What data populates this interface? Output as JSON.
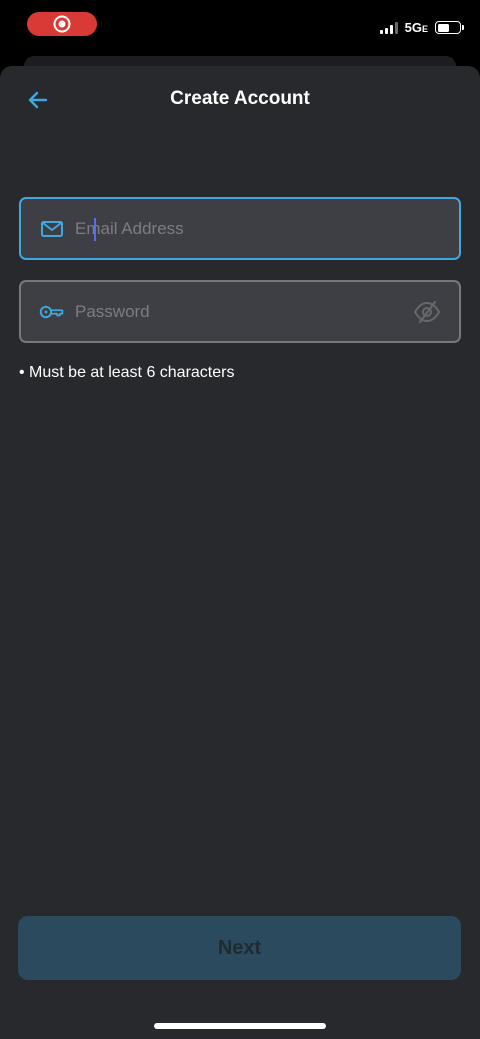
{
  "status_bar": {
    "network": "5G",
    "network_suffix": "E",
    "signal_bars": 3,
    "battery_level": 0.6,
    "recording_color": "#d93a35"
  },
  "header": {
    "title": "Create Account",
    "back_icon": "arrow-left-icon"
  },
  "form": {
    "email": {
      "placeholder": "Email Address",
      "value": "",
      "icon": "mail-icon"
    },
    "password": {
      "placeholder": "Password",
      "value": "",
      "icon": "key-icon",
      "toggle_icon": "eye-off-icon"
    },
    "hint": "• Must be at least 6 characters"
  },
  "actions": {
    "next_label": "Next"
  },
  "colors": {
    "accent": "#3ea8df",
    "background": "#27292d",
    "field_background": "#3e3f44",
    "button_disabled": "#2c4a5d"
  }
}
